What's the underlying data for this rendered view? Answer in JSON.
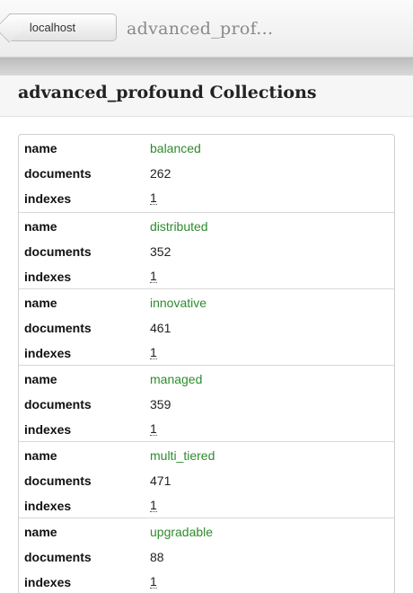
{
  "nav": {
    "back_label": "localhost",
    "title": "advanced_prof..."
  },
  "page": {
    "title": "advanced_profound Collections"
  },
  "labels": {
    "name": "name",
    "documents": "documents",
    "indexes": "indexes"
  },
  "collections": [
    {
      "name": "balanced",
      "documents": "262",
      "indexes": "1"
    },
    {
      "name": "distributed",
      "documents": "352",
      "indexes": "1"
    },
    {
      "name": "innovative",
      "documents": "461",
      "indexes": "1"
    },
    {
      "name": "managed",
      "documents": "359",
      "indexes": "1"
    },
    {
      "name": "multi_tiered",
      "documents": "471",
      "indexes": "1"
    },
    {
      "name": "upgradable",
      "documents": "88",
      "indexes": "1"
    }
  ],
  "colors": {
    "name_value": "#2e8b2e",
    "toolbar_shadow": "#c4c4c4"
  }
}
